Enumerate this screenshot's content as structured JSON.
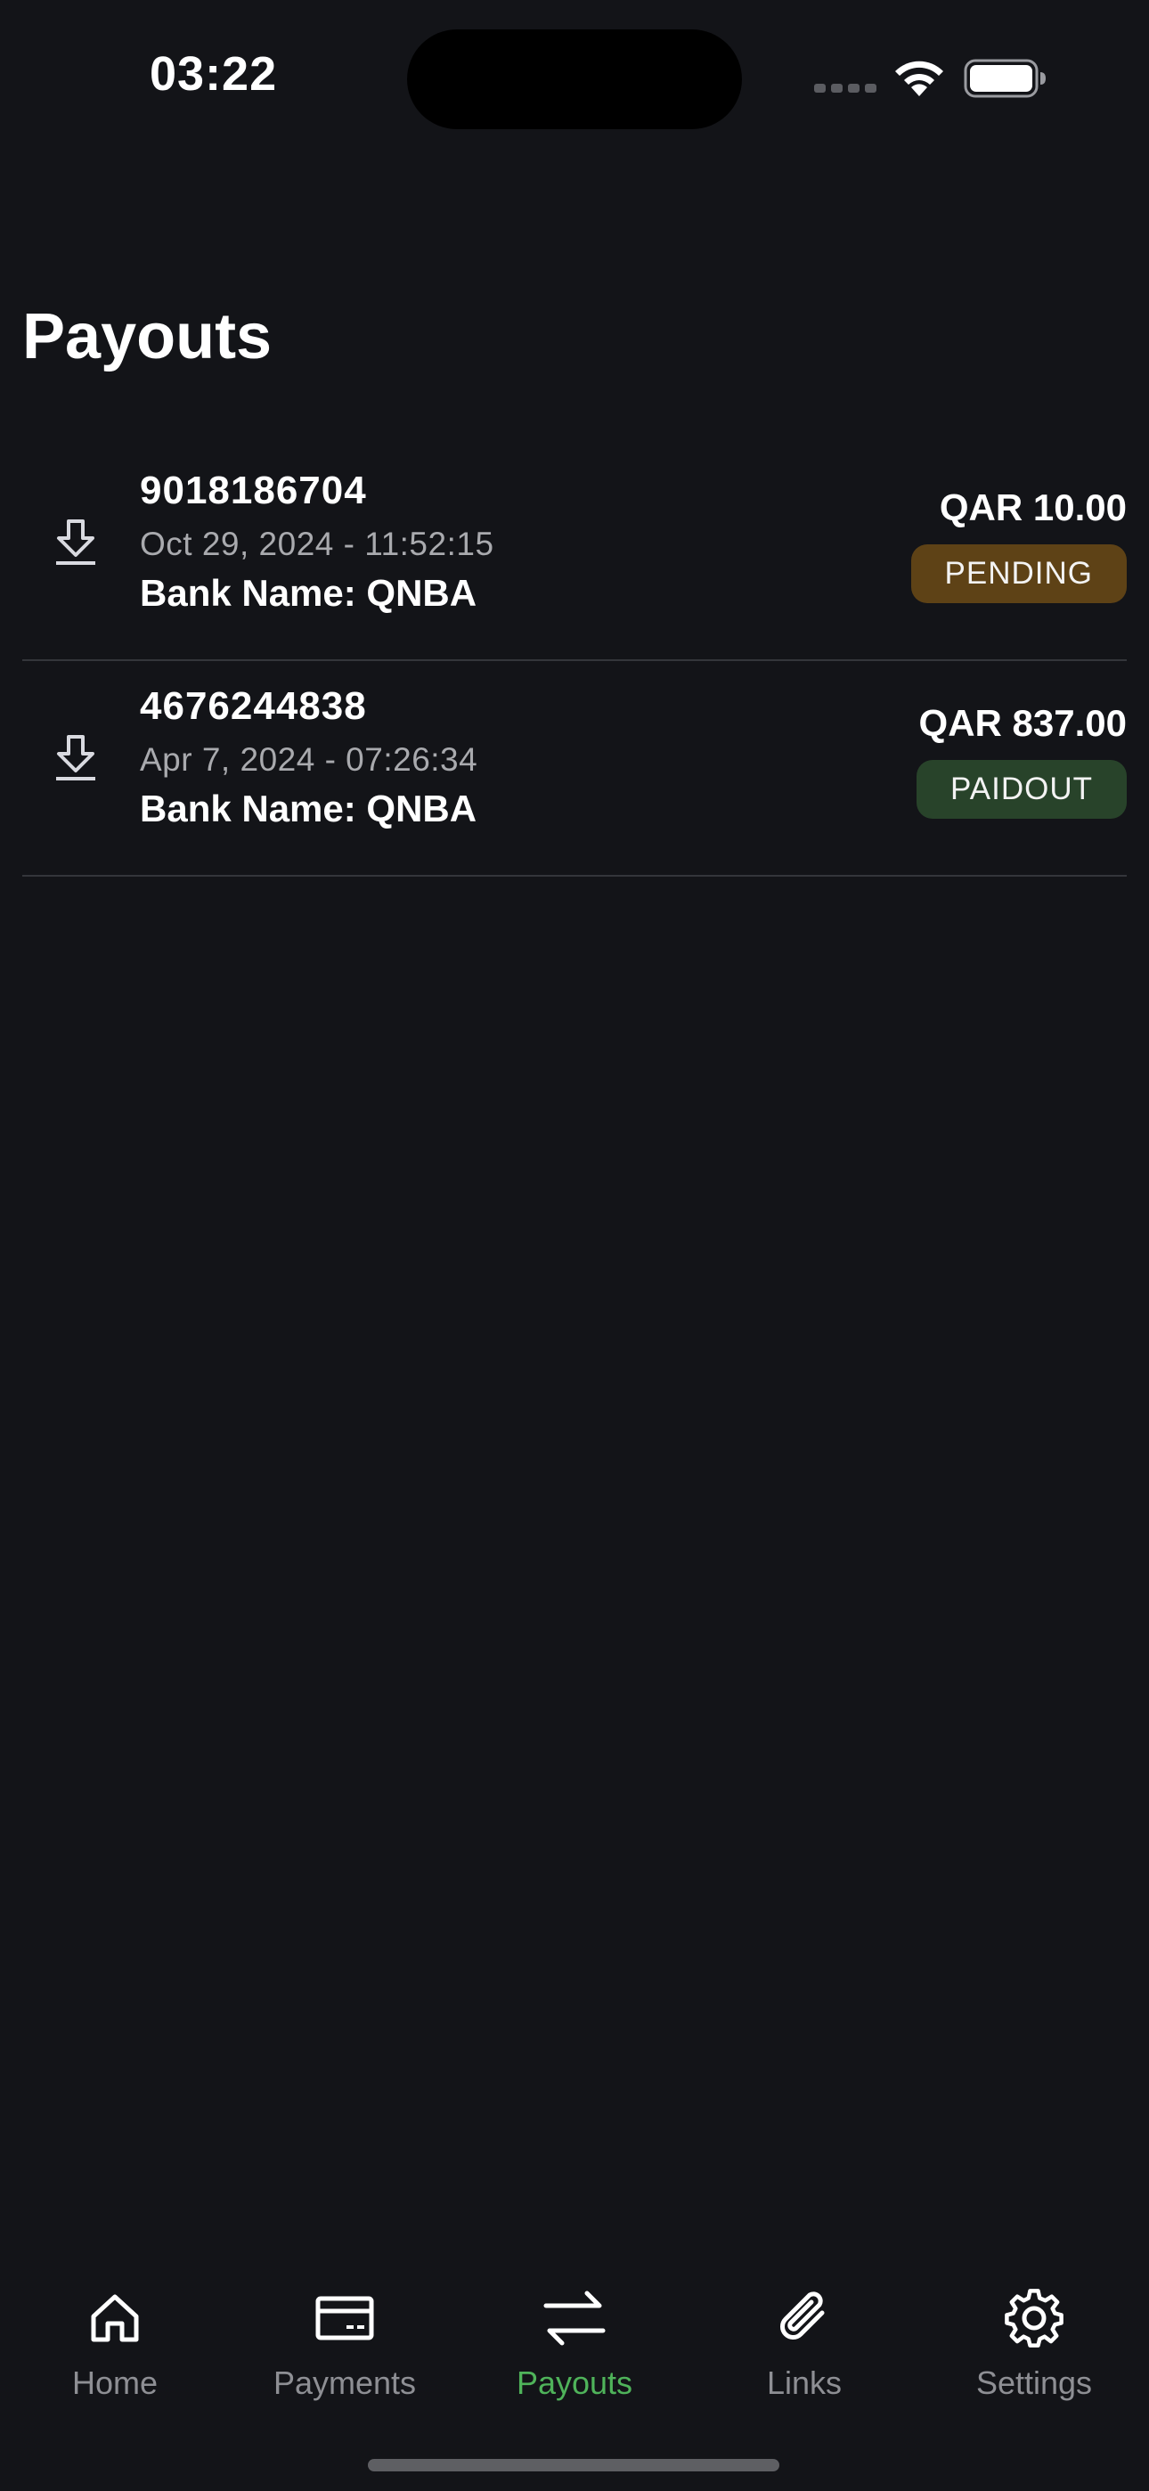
{
  "status_bar": {
    "time": "03:22",
    "wifi_icon": "wifi-icon",
    "battery_icon": "battery-full-icon"
  },
  "page": {
    "title": "Payouts"
  },
  "payouts": [
    {
      "id": "9018186704",
      "date": "Oct 29, 2024 - 11:52:15",
      "bank": "Bank Name: QNBA",
      "amount": "QAR 10.00",
      "status": "PENDING",
      "status_color": "#5e4216",
      "icon": "download-icon"
    },
    {
      "id": "4676244838",
      "date": "Apr 7, 2024 - 07:26:34",
      "bank": "Bank Name: QNBA",
      "amount": "QAR 837.00",
      "status": "PAIDOUT",
      "status_color": "#28432a",
      "icon": "download-icon"
    }
  ],
  "tabs": [
    {
      "label": "Home",
      "icon": "home-icon",
      "active": false
    },
    {
      "label": "Payments",
      "icon": "card-icon",
      "active": false
    },
    {
      "label": "Payouts",
      "icon": "transfer-arrows-icon",
      "active": true
    },
    {
      "label": "Links",
      "icon": "paperclip-icon",
      "active": false
    },
    {
      "label": "Settings",
      "icon": "gear-icon",
      "active": false
    }
  ],
  "colors": {
    "background": "#131418",
    "accent": "#4fb35a",
    "muted_text": "#a9aaae",
    "tab_inactive": "#8e8f94",
    "divider": "#34363b"
  }
}
